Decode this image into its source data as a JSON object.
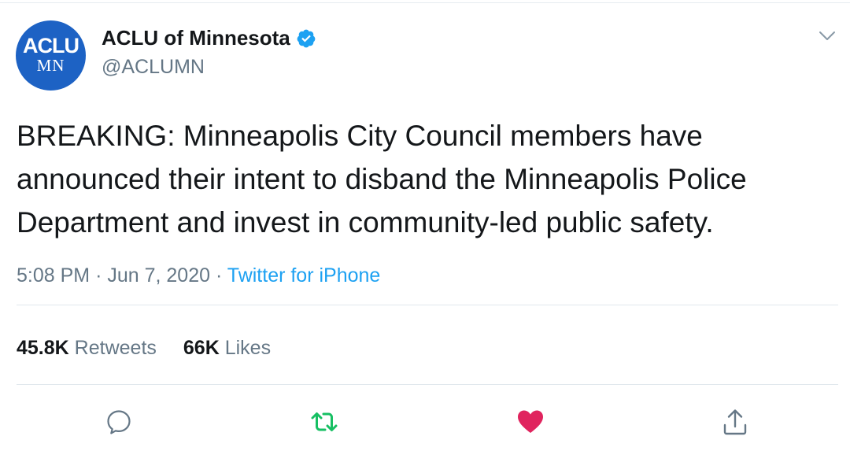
{
  "account": {
    "avatar_top": "ACLU",
    "avatar_bottom": "MN",
    "display_name": "ACLU of Minnesota",
    "handle": "@ACLUMN",
    "verified": true
  },
  "tweet": {
    "text": "BREAKING: Minneapolis City Council members have announced their intent to disband the Minneapolis Police Department and invest in community-led public safety.",
    "time": "5:08 PM",
    "separator": "·",
    "date": "Jun 7, 2020",
    "source": "Twitter for iPhone"
  },
  "stats": {
    "retweets_count": "45.8K",
    "retweets_label": "Retweets",
    "likes_count": "66K",
    "likes_label": "Likes"
  },
  "actions": {
    "reply_icon": "reply-icon",
    "retweet_icon": "retweet-icon",
    "like_icon": "heart-icon",
    "share_icon": "share-icon",
    "retweet_color": "#17bf63",
    "like_color": "#e0245e",
    "like_active": true
  },
  "colors": {
    "avatar_bg": "#1d62c4",
    "verified": "#1da1f2",
    "link": "#1da1f2",
    "secondary_text": "#657786"
  }
}
